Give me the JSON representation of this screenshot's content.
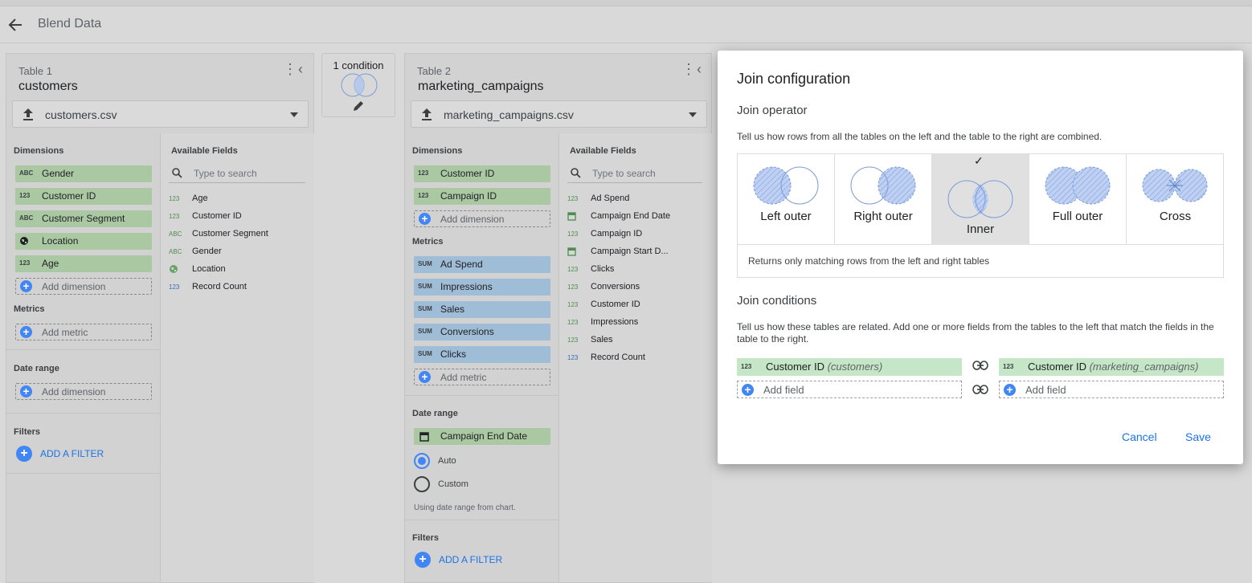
{
  "header": {
    "title": "Blend Data"
  },
  "table1": {
    "label": "Table 1",
    "name": "customers",
    "source": "customers.csv",
    "dimensions_header": "Dimensions",
    "dimensions": [
      {
        "icon": "ABC",
        "label": "Gender"
      },
      {
        "icon": "123",
        "label": "Customer ID"
      },
      {
        "icon": "ABC",
        "label": "Customer Segment"
      },
      {
        "icon": "globe",
        "label": "Location"
      },
      {
        "icon": "123",
        "label": "Age"
      }
    ],
    "add_dimension": "Add dimension",
    "metrics_header": "Metrics",
    "add_metric": "Add metric",
    "date_range_header": "Date range",
    "date_add_dimension": "Add dimension",
    "filters_header": "Filters",
    "add_filter": "ADD A FILTER",
    "available_header": "Available Fields",
    "search_placeholder": "Type to search",
    "fields": [
      {
        "icon": "123",
        "label": "Age"
      },
      {
        "icon": "123",
        "label": "Customer ID"
      },
      {
        "icon": "ABC",
        "label": "Customer Segment"
      },
      {
        "icon": "ABC",
        "label": "Gender"
      },
      {
        "icon": "globe",
        "label": "Location"
      },
      {
        "icon": "123",
        "label": "Record Count"
      }
    ]
  },
  "condition": {
    "label": "1 condition"
  },
  "table2": {
    "label": "Table 2",
    "name": "marketing_campaigns",
    "source": "marketing_campaigns.csv",
    "dimensions_header": "Dimensions",
    "dimensions": [
      {
        "icon": "123",
        "label": "Customer ID"
      },
      {
        "icon": "123",
        "label": "Campaign ID"
      }
    ],
    "add_dimension": "Add dimension",
    "metrics_header": "Metrics",
    "metrics": [
      {
        "icon": "SUM",
        "label": "Ad Spend"
      },
      {
        "icon": "SUM",
        "label": "Impressions"
      },
      {
        "icon": "SUM",
        "label": "Sales"
      },
      {
        "icon": "SUM",
        "label": "Conversions"
      },
      {
        "icon": "SUM",
        "label": "Clicks"
      }
    ],
    "add_metric": "Add metric",
    "date_range_header": "Date range",
    "date_field": "Campaign End Date",
    "date_auto": "Auto",
    "date_custom": "Custom",
    "date_note": "Using date range from chart.",
    "filters_header": "Filters",
    "add_filter": "ADD A FILTER",
    "available_header": "Available Fields",
    "search_placeholder": "Type to search",
    "fields": [
      {
        "icon": "123",
        "label": "Ad Spend"
      },
      {
        "icon": "cal",
        "label": "Campaign End Date"
      },
      {
        "icon": "123",
        "label": "Campaign ID"
      },
      {
        "icon": "cal",
        "label": "Campaign Start D..."
      },
      {
        "icon": "123",
        "label": "Clicks"
      },
      {
        "icon": "123",
        "label": "Conversions"
      },
      {
        "icon": "123",
        "label": "Customer ID"
      },
      {
        "icon": "123",
        "label": "Impressions"
      },
      {
        "icon": "123",
        "label": "Sales"
      },
      {
        "icon": "123",
        "label": "Record Count"
      }
    ]
  },
  "dialog": {
    "title": "Join configuration",
    "operator_header": "Join operator",
    "operator_desc": "Tell us how rows from all the tables on the left and the table to the right are combined.",
    "operators": [
      {
        "label": "Left outer",
        "selected": false
      },
      {
        "label": "Right outer",
        "selected": false
      },
      {
        "label": "Inner",
        "selected": true
      },
      {
        "label": "Full outer",
        "selected": false
      },
      {
        "label": "Cross",
        "selected": false
      }
    ],
    "operator_note": "Returns only matching rows from the left and right tables",
    "conditions_header": "Join conditions",
    "conditions_desc": "Tell us how these tables are related. Add one or more fields from the tables to the left that match the fields in the table to the right.",
    "left_field": {
      "icon": "123",
      "name": "Customer ID",
      "table": "(customers)"
    },
    "right_field": {
      "icon": "123",
      "name": "Customer ID",
      "table": "(marketing_campaigns)"
    },
    "add_field": "Add field",
    "cancel": "Cancel",
    "save": "Save"
  },
  "colors": {
    "dimension_chip": "#aac9a3",
    "metric_chip": "#9fbdd6",
    "accent": "#1a73e8",
    "join_field": "#c5e6c7"
  }
}
